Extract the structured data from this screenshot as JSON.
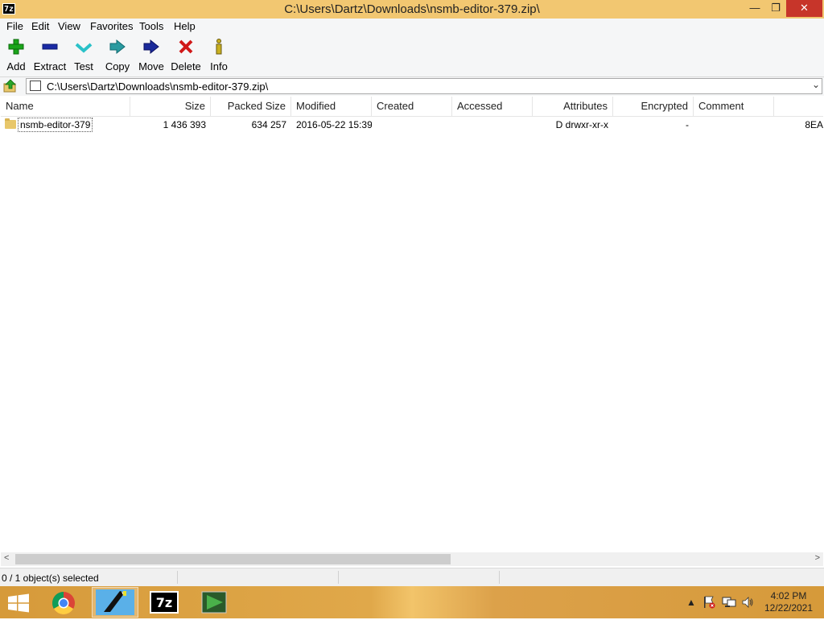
{
  "window": {
    "title": "C:\\Users\\Dartz\\Downloads\\nsmb-editor-379.zip\\",
    "app_icon_label": "7z",
    "buttons": {
      "minimize": "—",
      "maximize": "❐",
      "close": "✕"
    }
  },
  "menu": {
    "items": [
      "File",
      "Edit",
      "View",
      "Favorites",
      "Tools",
      "Help"
    ]
  },
  "toolbar": {
    "items": [
      {
        "label": "Add",
        "icon": "plus-icon",
        "color": "#1aa51a"
      },
      {
        "label": "Extract",
        "icon": "minus-icon",
        "color": "#1a2aa5"
      },
      {
        "label": "Test",
        "icon": "checkmark-icon",
        "color": "#2ac1c8"
      },
      {
        "label": "Copy",
        "icon": "double-arrow-right-icon",
        "color": "#2a9aa0"
      },
      {
        "label": "Move",
        "icon": "arrow-right-icon",
        "color": "#1a2a9a"
      },
      {
        "label": "Delete",
        "icon": "x-icon",
        "color": "#d01818"
      },
      {
        "label": "Info",
        "icon": "info-icon",
        "color": "#c8b020"
      }
    ]
  },
  "address": {
    "path": "C:\\Users\\Dartz\\Downloads\\nsmb-editor-379.zip\\",
    "dropdown": "⌄"
  },
  "columns": [
    "Name",
    "Size",
    "Packed Size",
    "Modified",
    "Created",
    "Accessed",
    "Attributes",
    "Encrypted",
    "Comment"
  ],
  "files": [
    {
      "name": "nsmb-editor-379",
      "size": "1 436 393",
      "packed_size": "634 257",
      "modified": "2016-05-22 15:39",
      "created": "",
      "accessed": "",
      "attributes": "D drwxr-xr-x",
      "encrypted": "-",
      "comment": "",
      "overflow": "8EA"
    }
  ],
  "scrollbar": {
    "left_arrow": "<",
    "right_arrow": ">"
  },
  "status": {
    "text": "0 / 1 object(s) selected"
  },
  "taskbar": {
    "apps": [
      "chrome",
      "pencil-app",
      "7-zip",
      "media-app"
    ],
    "tray_chevron": "▲",
    "clock": {
      "time": "4:02 PM",
      "date": "12/22/2021"
    }
  }
}
